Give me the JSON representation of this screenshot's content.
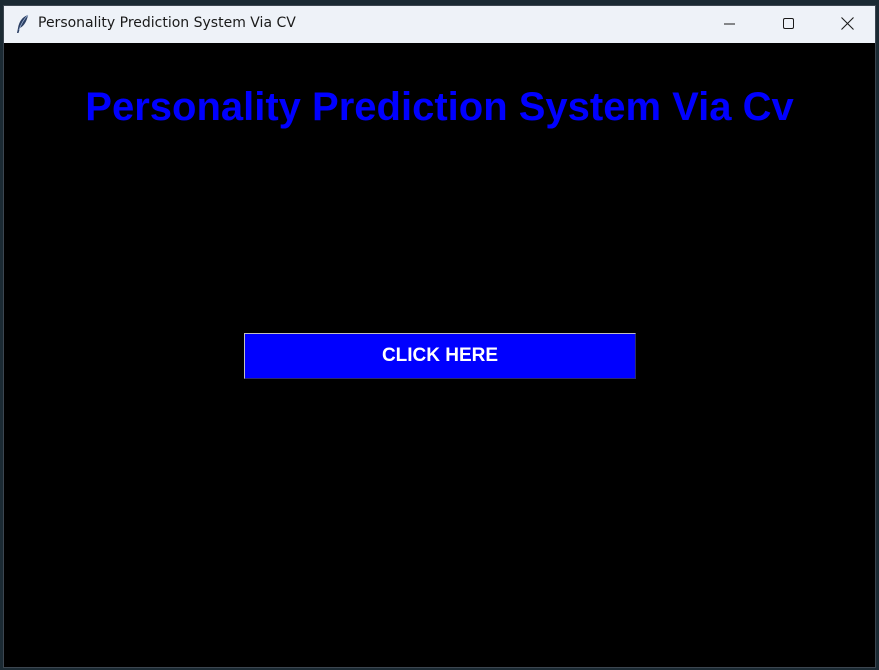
{
  "window": {
    "title": "Personality Prediction System Via CV",
    "icon": "feather-icon",
    "controls": {
      "minimize": "minimize-icon",
      "maximize": "maximize-icon",
      "close": "close-icon"
    }
  },
  "main": {
    "heading": "Personality Prediction System Via Cv",
    "button_label": "CLICK HERE"
  },
  "colors": {
    "background": "#000000",
    "heading": "#0000ff",
    "button_bg": "#0000ff",
    "button_text": "#ffffff",
    "titlebar": "#eef2f8"
  }
}
